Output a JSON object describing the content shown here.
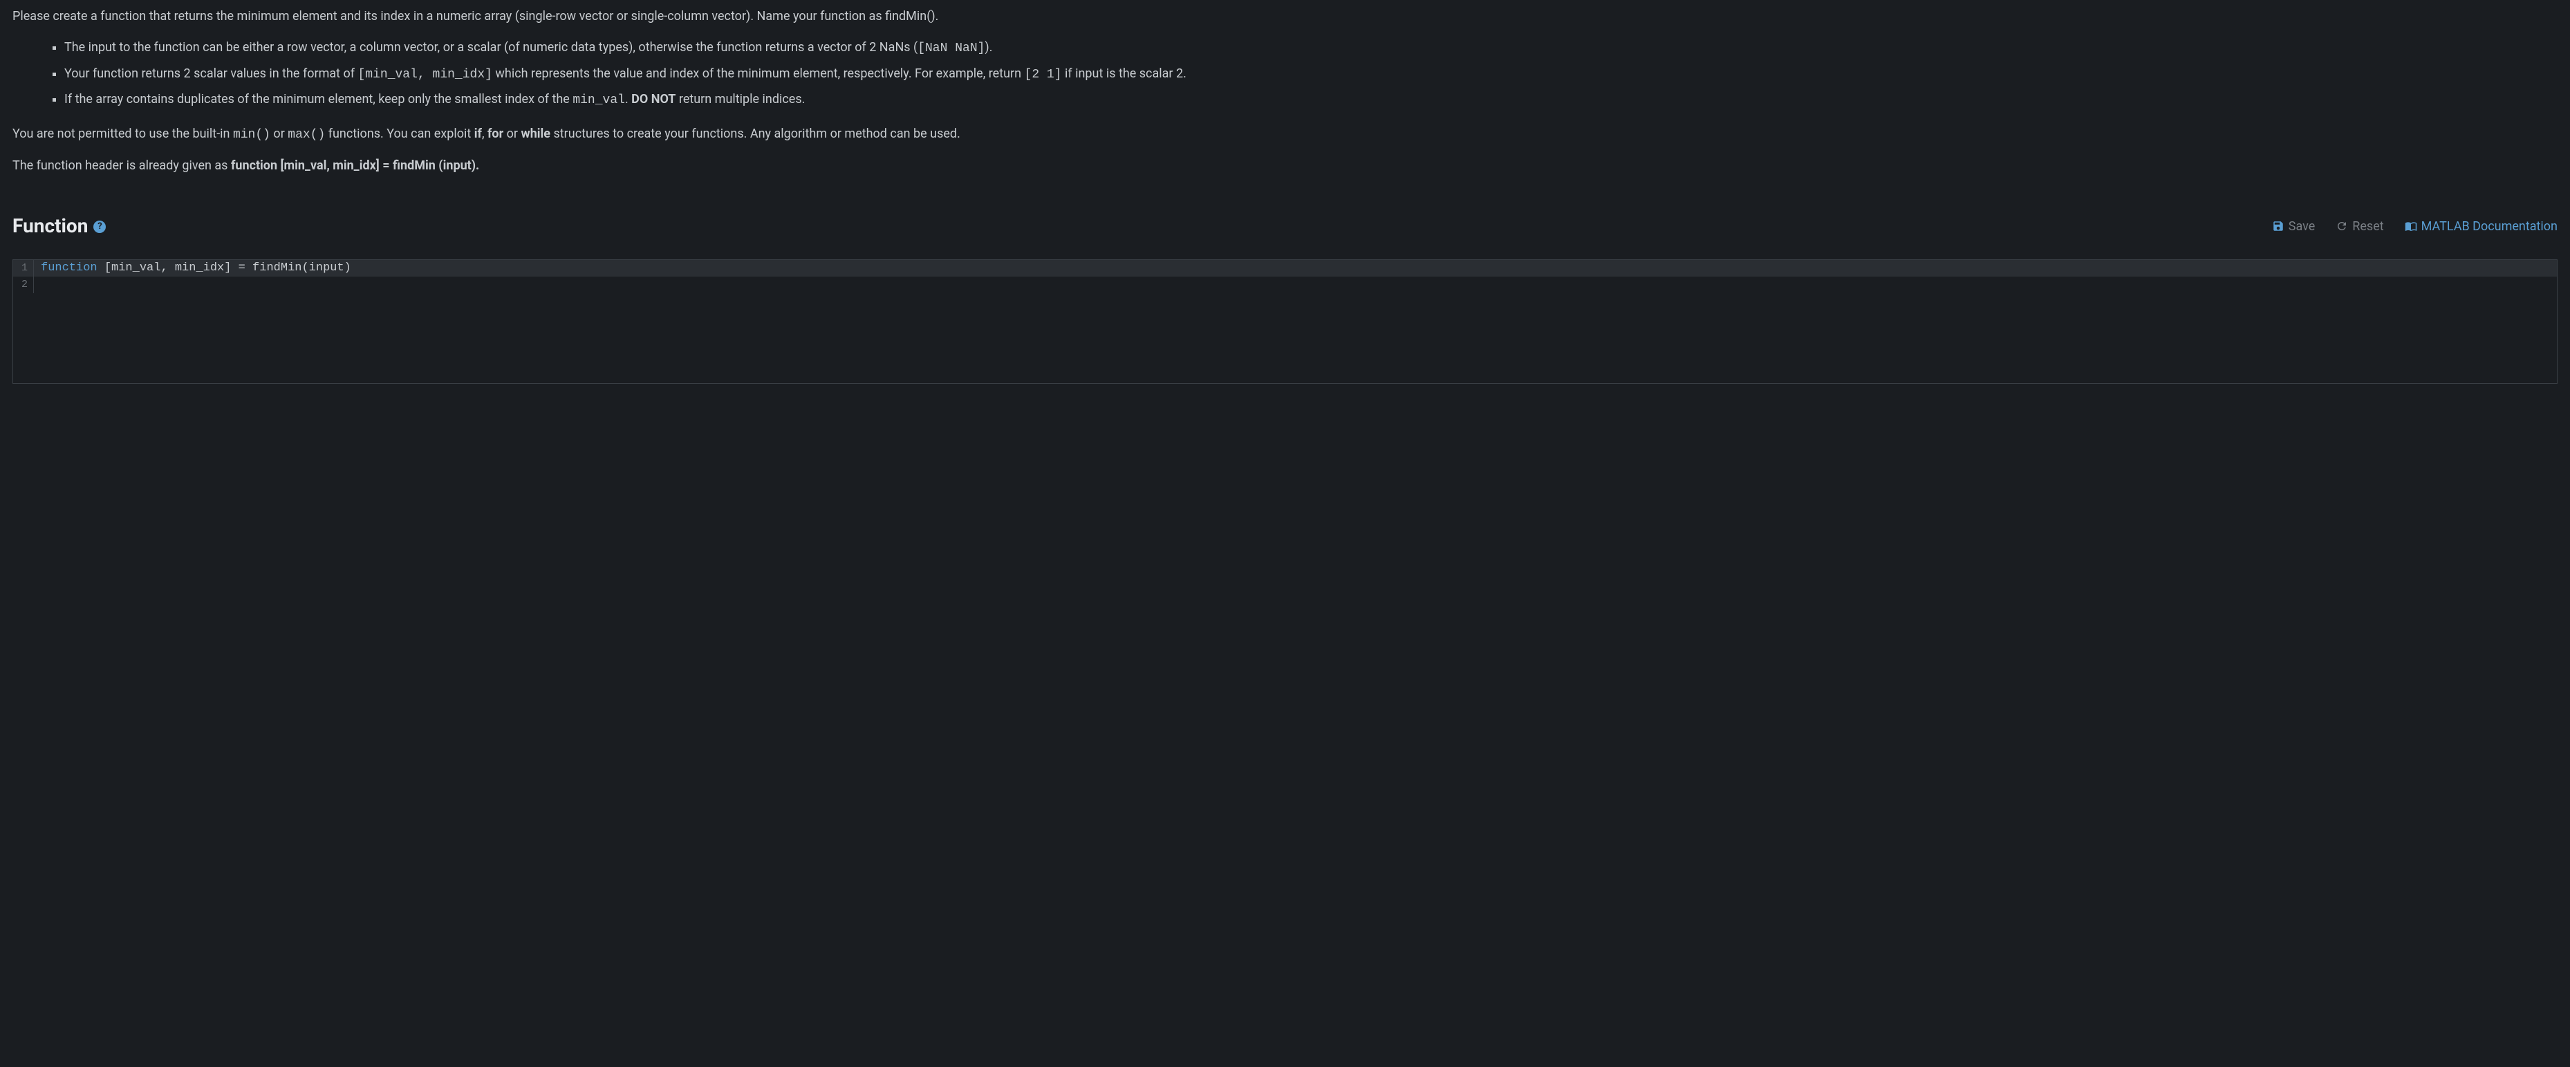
{
  "problem": {
    "intro": "Please create a function that returns the minimum element and its index in a numeric array (single-row vector or single-column vector). Name your function as findMin().",
    "bullets": [
      {
        "pre": "The input to the function can be either a row vector, a column vector, or a scalar (of numeric data types), otherwise the function returns a vector of 2 NaNs (",
        "code1": "[NaN NaN]",
        "post": ")."
      },
      {
        "pre": "Your function returns 2 scalar values in the format of ",
        "code1": "[min_val, min_idx]",
        "mid": " which represents the value and index of the minimum element, respectively. For example, return ",
        "code2": "[2 1]",
        "post": " if input is the scalar 2."
      },
      {
        "pre": "If the array contains duplicates of the minimum element, keep only the smallest index of the ",
        "code1": "min_val",
        "mid": ". ",
        "bold1": "DO NOT",
        "post": " return multiple indices."
      }
    ],
    "restriction": {
      "pre": "You are not permitted to use the built-in ",
      "code1": "min()",
      "mid1": " or ",
      "code2": "max()",
      "mid2": " functions. You can exploit ",
      "bold1": "if",
      "mid3": ", ",
      "bold2": "for",
      "mid4": " or ",
      "bold3": "while",
      "post": " structures to create your functions. Any algorithm or method can be used."
    },
    "header_note": {
      "pre": "The function header is already given as ",
      "bold": "function [min_val, min_idx] = findMin (input).",
      "post": ""
    }
  },
  "section": {
    "title": "Function",
    "help_symbol": "?"
  },
  "toolbar": {
    "save_label": "Save",
    "reset_label": "Reset",
    "docs_label": "MATLAB Documentation"
  },
  "editor": {
    "lines": [
      {
        "num": "1",
        "keyword": "function",
        "rest": " [min_val, min_idx] = findMin(input)"
      },
      {
        "num": "2",
        "keyword": "",
        "rest": ""
      }
    ]
  }
}
